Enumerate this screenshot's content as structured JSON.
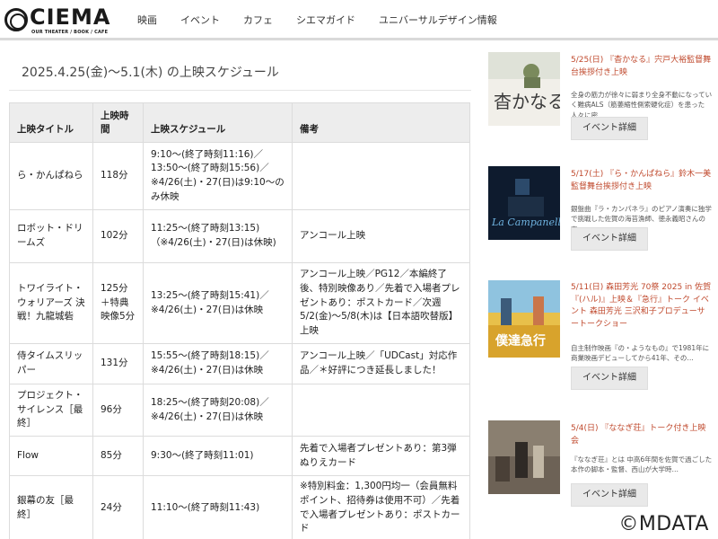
{
  "header": {
    "logo_text": "CIEMA",
    "logo_sub": "OUR THEATER / BOOK / CAFE",
    "nav": [
      "映画",
      "イベント",
      "カフェ",
      "シエマガイド",
      "ユニバーサルデザイン情報"
    ]
  },
  "schedule": {
    "title": "2025.4.25(金)～5.1(木) の上映スケジュール",
    "headers": [
      "上映タイトル",
      "上映時間",
      "上映スケジュール",
      "備考"
    ],
    "rows": [
      {
        "title": "ら・かんぱねら",
        "duration": "118分",
        "schedule": "9:10～(終了時刻11:16)／13:50～(終了時刻15:56)／※4/26(土)・27(日)は9:10～のみ休映",
        "note": ""
      },
      {
        "title": "ロボット・ドリームズ",
        "duration": "102分",
        "schedule": "11:25～(終了時刻13:15)（※4/26(土)・27(日)は休映)",
        "note": "アンコール上映"
      },
      {
        "title": "トワイライト・ウォリアーズ 決戦！九龍城砦",
        "duration": "125分＋特典映像5分",
        "schedule": "13:25～(終了時刻15:41)／※4/26(土)・27(日)は休映",
        "note": "アンコール上映／PG12／本編終了後、特別映像あり／先着で入場者プレゼントあり：ポストカード／次週5/2(金)～5/8(木)は【日本語吹替版】上映"
      },
      {
        "title": "侍タイムスリッパー",
        "duration": "131分",
        "schedule": "15:55～(終了時刻18:15)／※4/26(土)・27(日)は休映",
        "note": "アンコール上映／「UDCast」対応作品／＊好評につき延長しました！"
      },
      {
        "title": "プロジェクト・サイレンス［最終］",
        "duration": "96分",
        "schedule": "18:25～(終了時刻20:08)／※4/26(土)・27(日)は休映",
        "note": ""
      },
      {
        "title": "Flow",
        "duration": "85分",
        "schedule": "9:30～(終了時刻11:01)",
        "note": "先着で入場者プレゼントあり：第3弾ぬりえカード"
      },
      {
        "title": "銀幕の友［最終］",
        "duration": "24分",
        "schedule": "11:10～(終了時刻11:43)",
        "note": "※特別料金：1,300円均一（会員無料ポイント、招待券は使用不可）／先着で入場者プレゼントあり：ポストカード"
      }
    ]
  },
  "events": [
    {
      "head": "5/25(日) 『杳かなる』宍戸大裕監督舞台挨拶付き上映",
      "desc": "全身の筋力が徐々に弱まり全身不動になっていく難病ALS（筋萎縮性側索硬化症）を患った人々に密…",
      "button": "イベント詳細",
      "poster_text": "杳かなる"
    },
    {
      "head": "5/17(土) 『ら・かんぱねら』鈴木一美監督舞台挨拶付き上映",
      "desc": "銀盤曲『ラ・カンパネラ』のピアノ演奏に独学で挑戦した佐賀の海苔漁師、徳永義昭さんの実…",
      "button": "イベント詳細",
      "poster_text": "La Campanella"
    },
    {
      "head": "5/11(日) 森田芳光 70祭 2025 in 佐賀『(ハル)』上映＆『急行』トーク イベント 森田芳光 三沢和子プロデューサートークショー",
      "desc": "自主制作映画『の・ようなもの』で1981年に商業映画デビューしてから41年、その…",
      "button": "イベント詳細",
      "poster_text": "僕達急行"
    },
    {
      "head": "5/4(日) 『ななぎ荘』トーク付き上映会",
      "desc": "『ななぎ荘』とは 中高6年間を佐賀で過ごした本作の脚本・監督、西山が大学時…",
      "button": "イベント詳細",
      "poster_text": ""
    }
  ],
  "watermark": "©MDATA"
}
